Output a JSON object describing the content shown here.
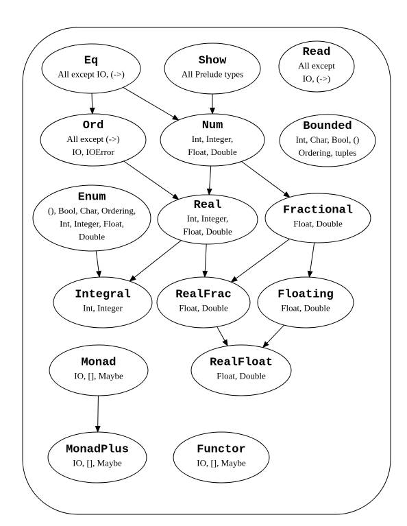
{
  "nodes": [
    {
      "id": "Eq",
      "title": "Eq",
      "lines": [
        "All except IO, (->)"
      ]
    },
    {
      "id": "Show",
      "title": "Show",
      "lines": [
        "All Prelude types"
      ]
    },
    {
      "id": "Read",
      "title": "Read",
      "lines": [
        "All except",
        "IO, (->)"
      ]
    },
    {
      "id": "Ord",
      "title": "Ord",
      "lines": [
        "All except (->)",
        "IO,  IOError"
      ]
    },
    {
      "id": "Num",
      "title": "Num",
      "lines": [
        "Int, Integer,",
        "Float, Double"
      ]
    },
    {
      "id": "Bounded",
      "title": "Bounded",
      "lines": [
        "Int, Char, Bool, ()",
        "Ordering, tuples"
      ]
    },
    {
      "id": "Enum",
      "title": "Enum",
      "lines": [
        "(), Bool, Char, Ordering,",
        "Int, Integer, Float,",
        "Double"
      ]
    },
    {
      "id": "Real",
      "title": "Real",
      "lines": [
        "Int, Integer,",
        "Float, Double"
      ]
    },
    {
      "id": "Fractional",
      "title": "Fractional",
      "lines": [
        "Float, Double"
      ]
    },
    {
      "id": "Integral",
      "title": "Integral",
      "lines": [
        "Int, Integer"
      ]
    },
    {
      "id": "RealFrac",
      "title": "RealFrac",
      "lines": [
        "Float, Double"
      ]
    },
    {
      "id": "Floating",
      "title": "Floating",
      "lines": [
        "Float, Double"
      ]
    },
    {
      "id": "Monad",
      "title": "Monad",
      "lines": [
        "IO, [], Maybe"
      ]
    },
    {
      "id": "RealFloat",
      "title": "RealFloat",
      "lines": [
        "Float, Double"
      ]
    },
    {
      "id": "MonadPlus",
      "title": "MonadPlus",
      "lines": [
        "IO, [], Maybe"
      ]
    },
    {
      "id": "Functor",
      "title": "Functor",
      "lines": [
        "IO, [], Maybe"
      ]
    }
  ],
  "edges": [
    [
      "Eq",
      "Ord"
    ],
    [
      "Eq",
      "Num"
    ],
    [
      "Show",
      "Num"
    ],
    [
      "Ord",
      "Real"
    ],
    [
      "Num",
      "Real"
    ],
    [
      "Num",
      "Fractional"
    ],
    [
      "Enum",
      "Integral"
    ],
    [
      "Real",
      "Integral"
    ],
    [
      "Real",
      "RealFrac"
    ],
    [
      "Fractional",
      "RealFrac"
    ],
    [
      "Fractional",
      "Floating"
    ],
    [
      "RealFrac",
      "RealFloat"
    ],
    [
      "Floating",
      "RealFloat"
    ],
    [
      "Monad",
      "MonadPlus"
    ]
  ]
}
